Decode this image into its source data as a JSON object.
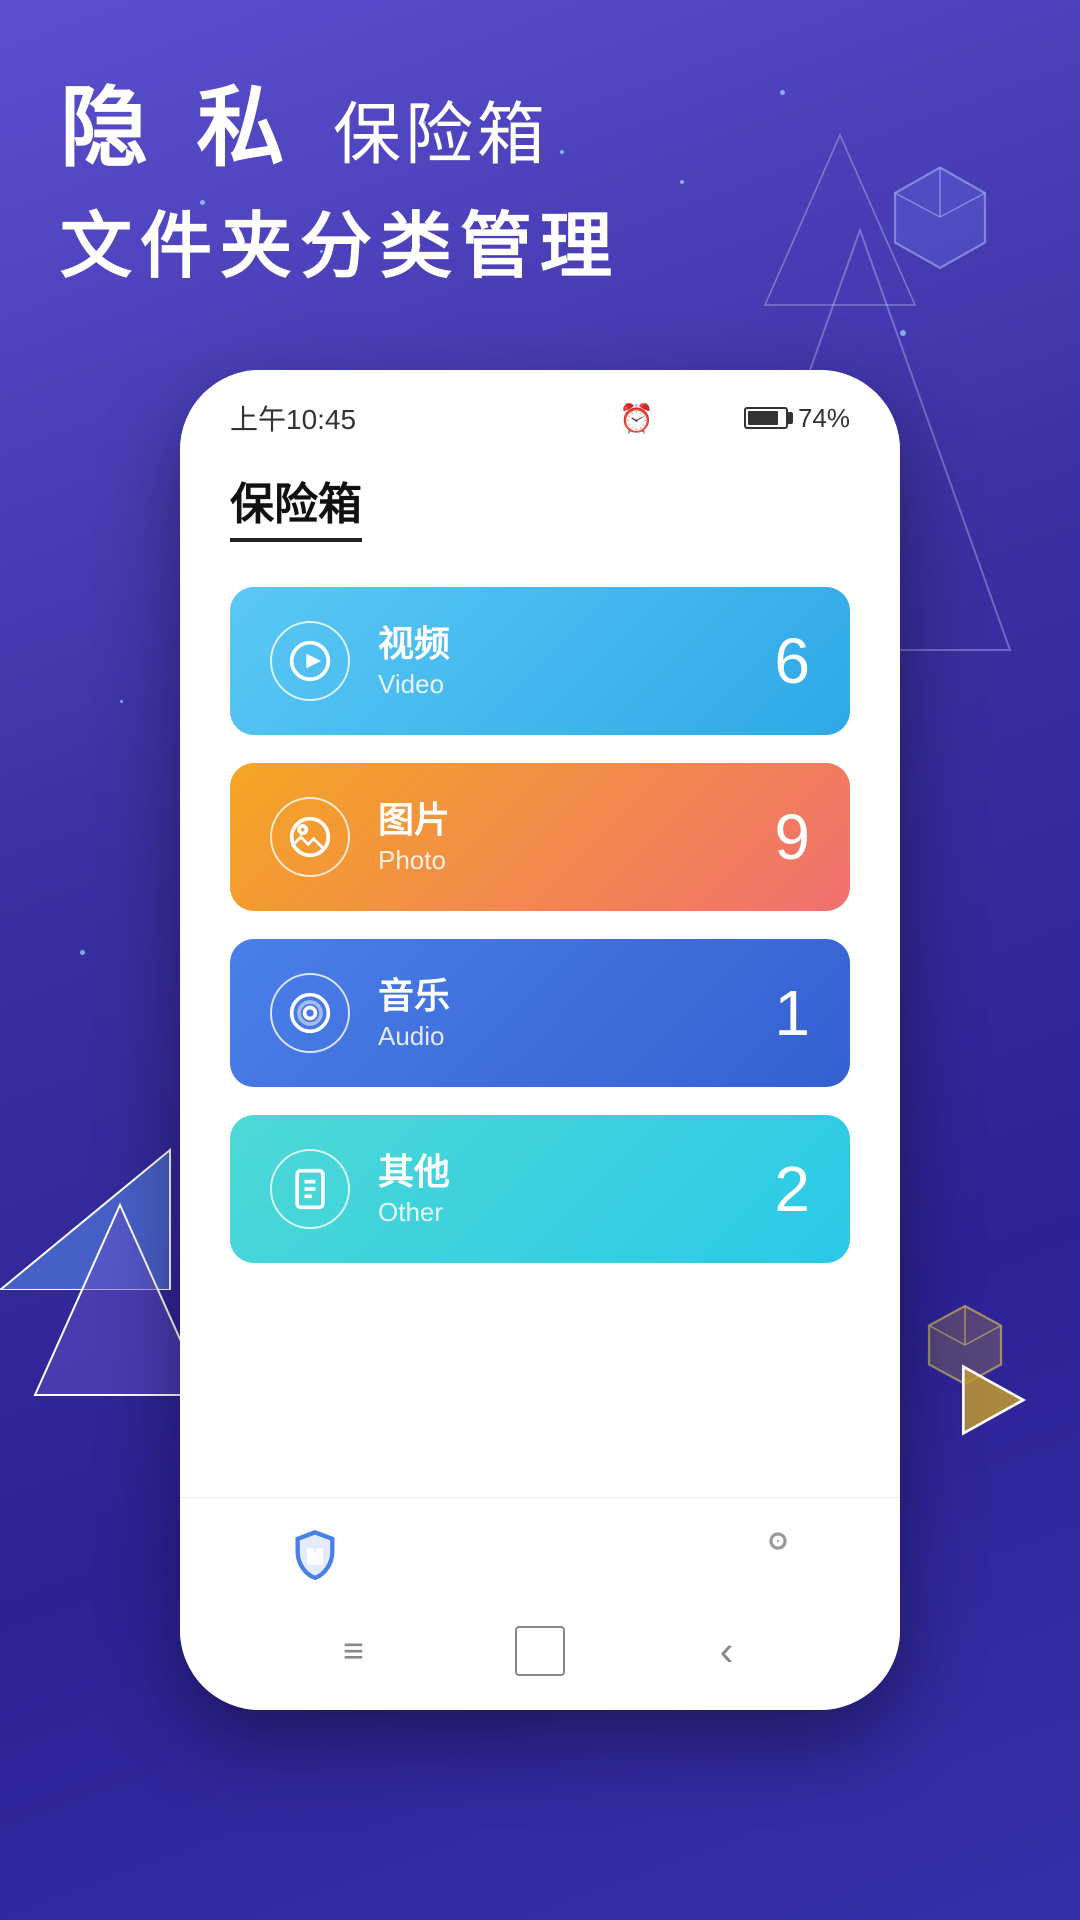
{
  "background": {
    "gradient_start": "#5b4fcf",
    "gradient_end": "#2d2195"
  },
  "header": {
    "line1_main": "隐 私",
    "line1_sub": "保险箱",
    "line2": "文件夹分类管理"
  },
  "status_bar": {
    "time": "上午10:45",
    "battery_percent": "74%"
  },
  "app": {
    "title": "保险箱",
    "settings_icon": "gear-icon"
  },
  "categories": [
    {
      "id": "video",
      "name_zh": "视频",
      "name_en": "Video",
      "count": "6",
      "gradient_start": "#5bc8f5",
      "gradient_end": "#2ea8e8",
      "icon": "play-icon"
    },
    {
      "id": "photo",
      "name_zh": "图片",
      "name_en": "Photo",
      "count": "9",
      "gradient_start": "#f5a623",
      "gradient_end": "#f07070",
      "icon": "photo-icon"
    },
    {
      "id": "audio",
      "name_zh": "音乐",
      "name_en": "Audio",
      "count": "1",
      "gradient_start": "#4a7fe8",
      "gradient_end": "#3560d0",
      "icon": "music-icon"
    },
    {
      "id": "other",
      "name_zh": "其他",
      "name_en": "Other",
      "count": "2",
      "gradient_start": "#4dd9d5",
      "gradient_end": "#2bc8e8",
      "icon": "file-icon"
    }
  ],
  "bottom_nav": [
    {
      "id": "vault",
      "icon": "shield-icon",
      "active": true
    },
    {
      "id": "list",
      "icon": "list-icon",
      "active": false
    },
    {
      "id": "apps",
      "icon": "apps-icon",
      "active": false
    },
    {
      "id": "profile",
      "icon": "profile-icon",
      "active": false
    }
  ],
  "android_nav": {
    "menu_label": "≡",
    "home_label": "□",
    "back_label": "‹"
  }
}
